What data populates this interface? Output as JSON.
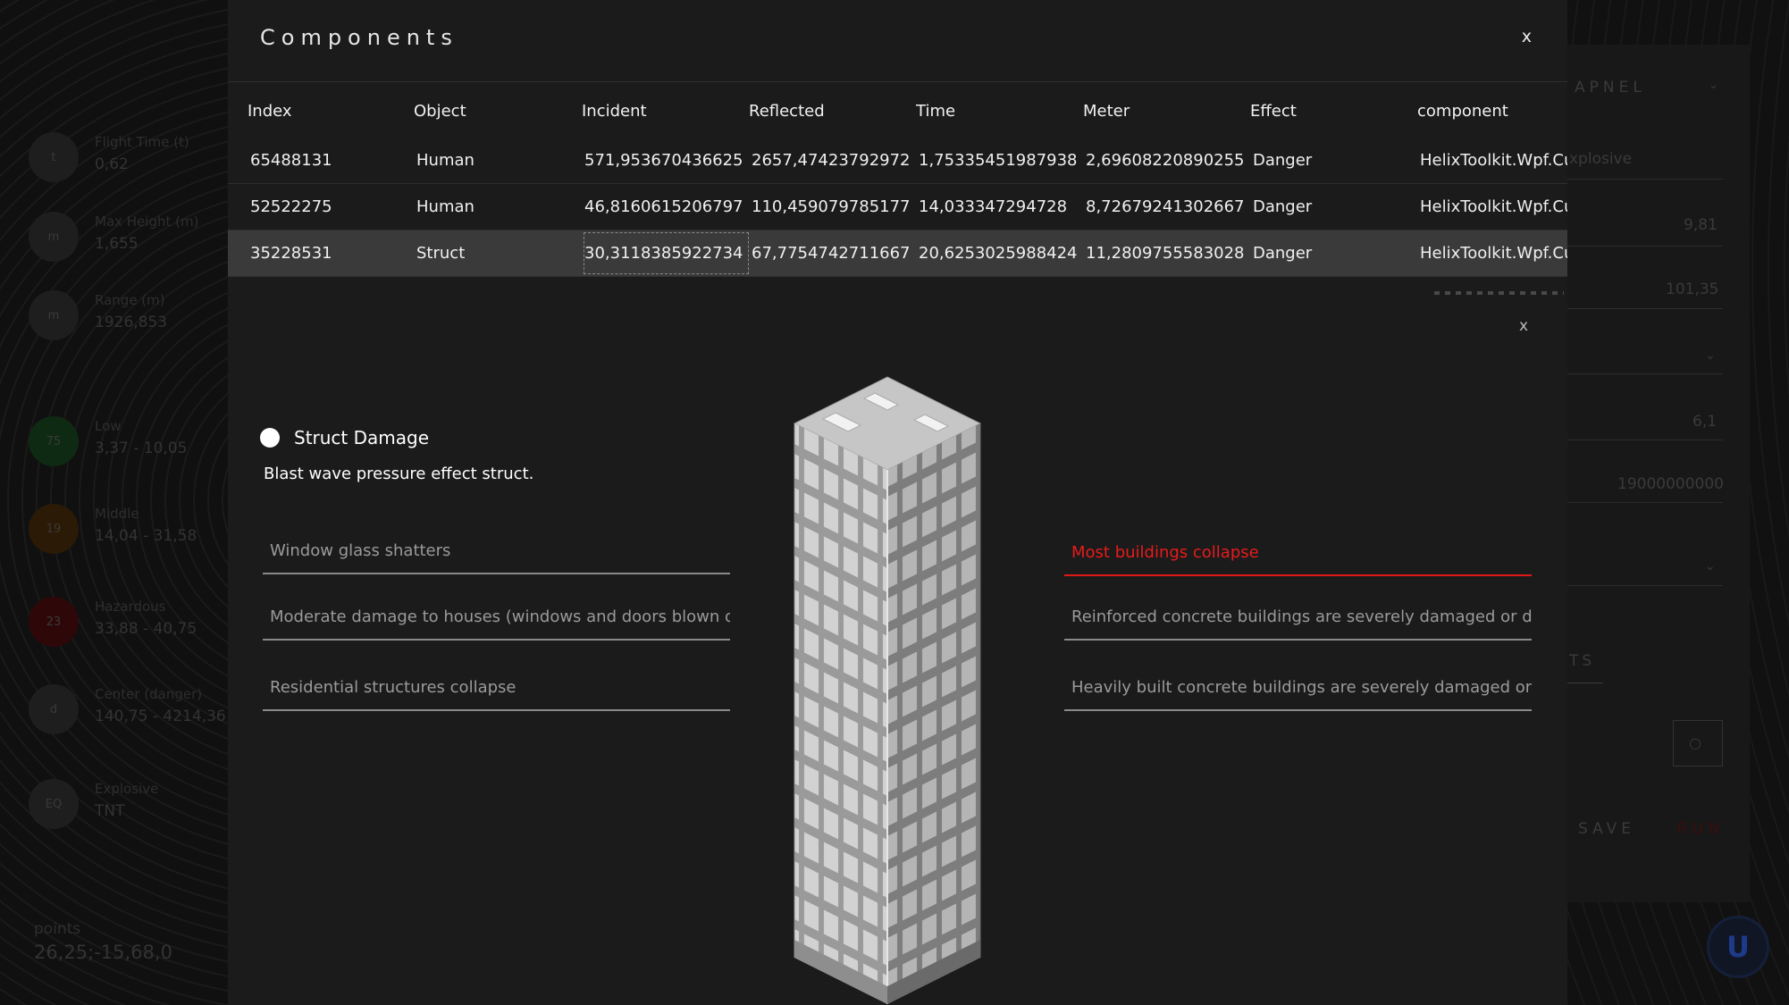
{
  "background_left": {
    "stats": [
      {
        "badge": "t",
        "label": "Flight Time (t)",
        "value": "0,62"
      },
      {
        "badge": "m",
        "label": "Max Height (m)",
        "value": "1,655"
      },
      {
        "badge": "m",
        "label": "Range (m)",
        "value": "1926,853"
      },
      {
        "badge": "75",
        "label": "Low",
        "value": "3,37 - 10,05",
        "color": "#0f2a12"
      },
      {
        "badge": "19",
        "label": "Middle",
        "value": "14,04 - 31,58",
        "color": "#2a1a06"
      },
      {
        "badge": "23",
        "label": "Hazardous",
        "value": "33,88 - 40,75",
        "color": "#2e0808"
      },
      {
        "badge": "d",
        "label": "Center (danger)",
        "value": "140,75 - 4214,36"
      },
      {
        "badge": "EQ",
        "label": "Explosive",
        "value": "TNT"
      }
    ],
    "points_label": "points",
    "points_value": "26,25;-15,68,0"
  },
  "background_right": {
    "panel_title": "APNEL",
    "explosive_label": "xplosive",
    "values": [
      "9,81",
      "101,35",
      "6,1",
      "19000000000"
    ],
    "tab_label": "TS",
    "save_label": "SAVE",
    "run_label": "RUN"
  },
  "dialog": {
    "title": "Components",
    "close_label": "x",
    "columns": [
      "Index",
      "Object",
      "Incident",
      "Reflected",
      "Time",
      "Meter",
      "Effect",
      "component"
    ],
    "rows": [
      [
        "65488131",
        "Human",
        "571,953670436625",
        "2657,47423792972",
        "1,75335451987938",
        "2,69608220890255",
        "Danger",
        "HelixToolkit.Wpf.Cub"
      ],
      [
        "52522275",
        "Human",
        "46,8160615206797",
        "110,459079785177",
        "14,033347294728",
        "8,72679241302667",
        "Danger",
        "HelixToolkit.Wpf.Cub"
      ],
      [
        "35228531",
        "Struct",
        "30,3118385922734",
        "67,7754742711667",
        "20,6253025988424",
        "11,2809755583028",
        "Danger",
        "HelixToolkit.Wpf.Cub"
      ]
    ],
    "selected_row": 2
  },
  "detail": {
    "close_label": "x",
    "title": "Struct Damage",
    "description": "Blast wave pressure effect struct.",
    "left_effects": [
      "Window glass shatters",
      "Moderate damage to houses (windows and doors blown out ar",
      "Residential structures collapse"
    ],
    "right_effects": [
      "Most buildings collapse",
      "Reinforced concrete buildings are severely damaged or demolis",
      "Heavily built concrete buildings are severely damaged or demo"
    ],
    "active_effect_color": "#e81b1b"
  },
  "icons": {
    "building": "building-icon"
  }
}
